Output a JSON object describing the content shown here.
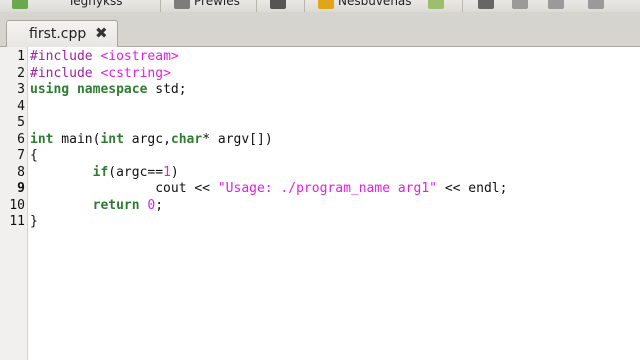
{
  "toolbar": {
    "items": [
      {
        "label": "Tegnykss",
        "icon": "new-file-icon"
      },
      {
        "label": "Prewies",
        "icon": "printer-icon"
      },
      {
        "label": "Nesbuvenas",
        "icon": "folder-icon"
      }
    ]
  },
  "tab": {
    "filename": "first.cpp",
    "close_glyph": "✖"
  },
  "editor": {
    "line_numbers": [
      "1",
      "2",
      "3",
      "4",
      "5",
      "6",
      "7",
      "8",
      "9",
      "10",
      "11"
    ]
  }
}
